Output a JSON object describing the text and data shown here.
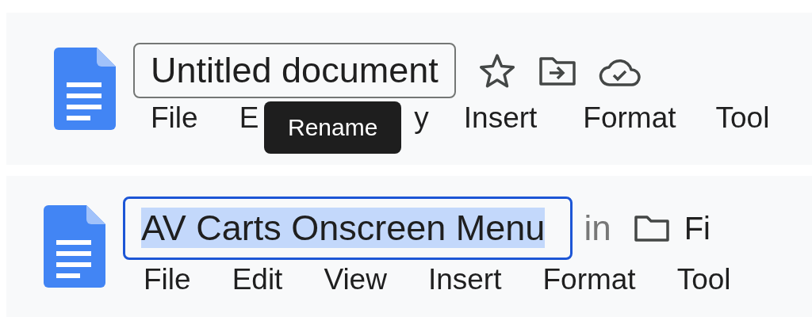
{
  "panels": [
    {
      "title_field": {
        "value": "Untitled document",
        "focused": false,
        "text_selected": false
      },
      "actions": [
        {
          "kind": "star"
        },
        {
          "kind": "move"
        },
        {
          "kind": "cloud"
        }
      ],
      "menu": [
        {
          "label": "File"
        },
        {
          "label": "E"
        },
        {
          "label": "y"
        },
        {
          "label": "Insert"
        },
        {
          "label": "Format"
        },
        {
          "label": "Tool"
        }
      ],
      "tooltip": "Rename"
    },
    {
      "title_field": {
        "value": "AV Carts Onscreen Menu",
        "focused": true,
        "text_selected": true
      },
      "location": {
        "prefix": "in",
        "folder_name": "Fi"
      },
      "menu": [
        {
          "label": "File"
        },
        {
          "label": "Edit"
        },
        {
          "label": "View"
        },
        {
          "label": "Insert"
        },
        {
          "label": "Format"
        },
        {
          "label": "Tool"
        }
      ]
    }
  ]
}
